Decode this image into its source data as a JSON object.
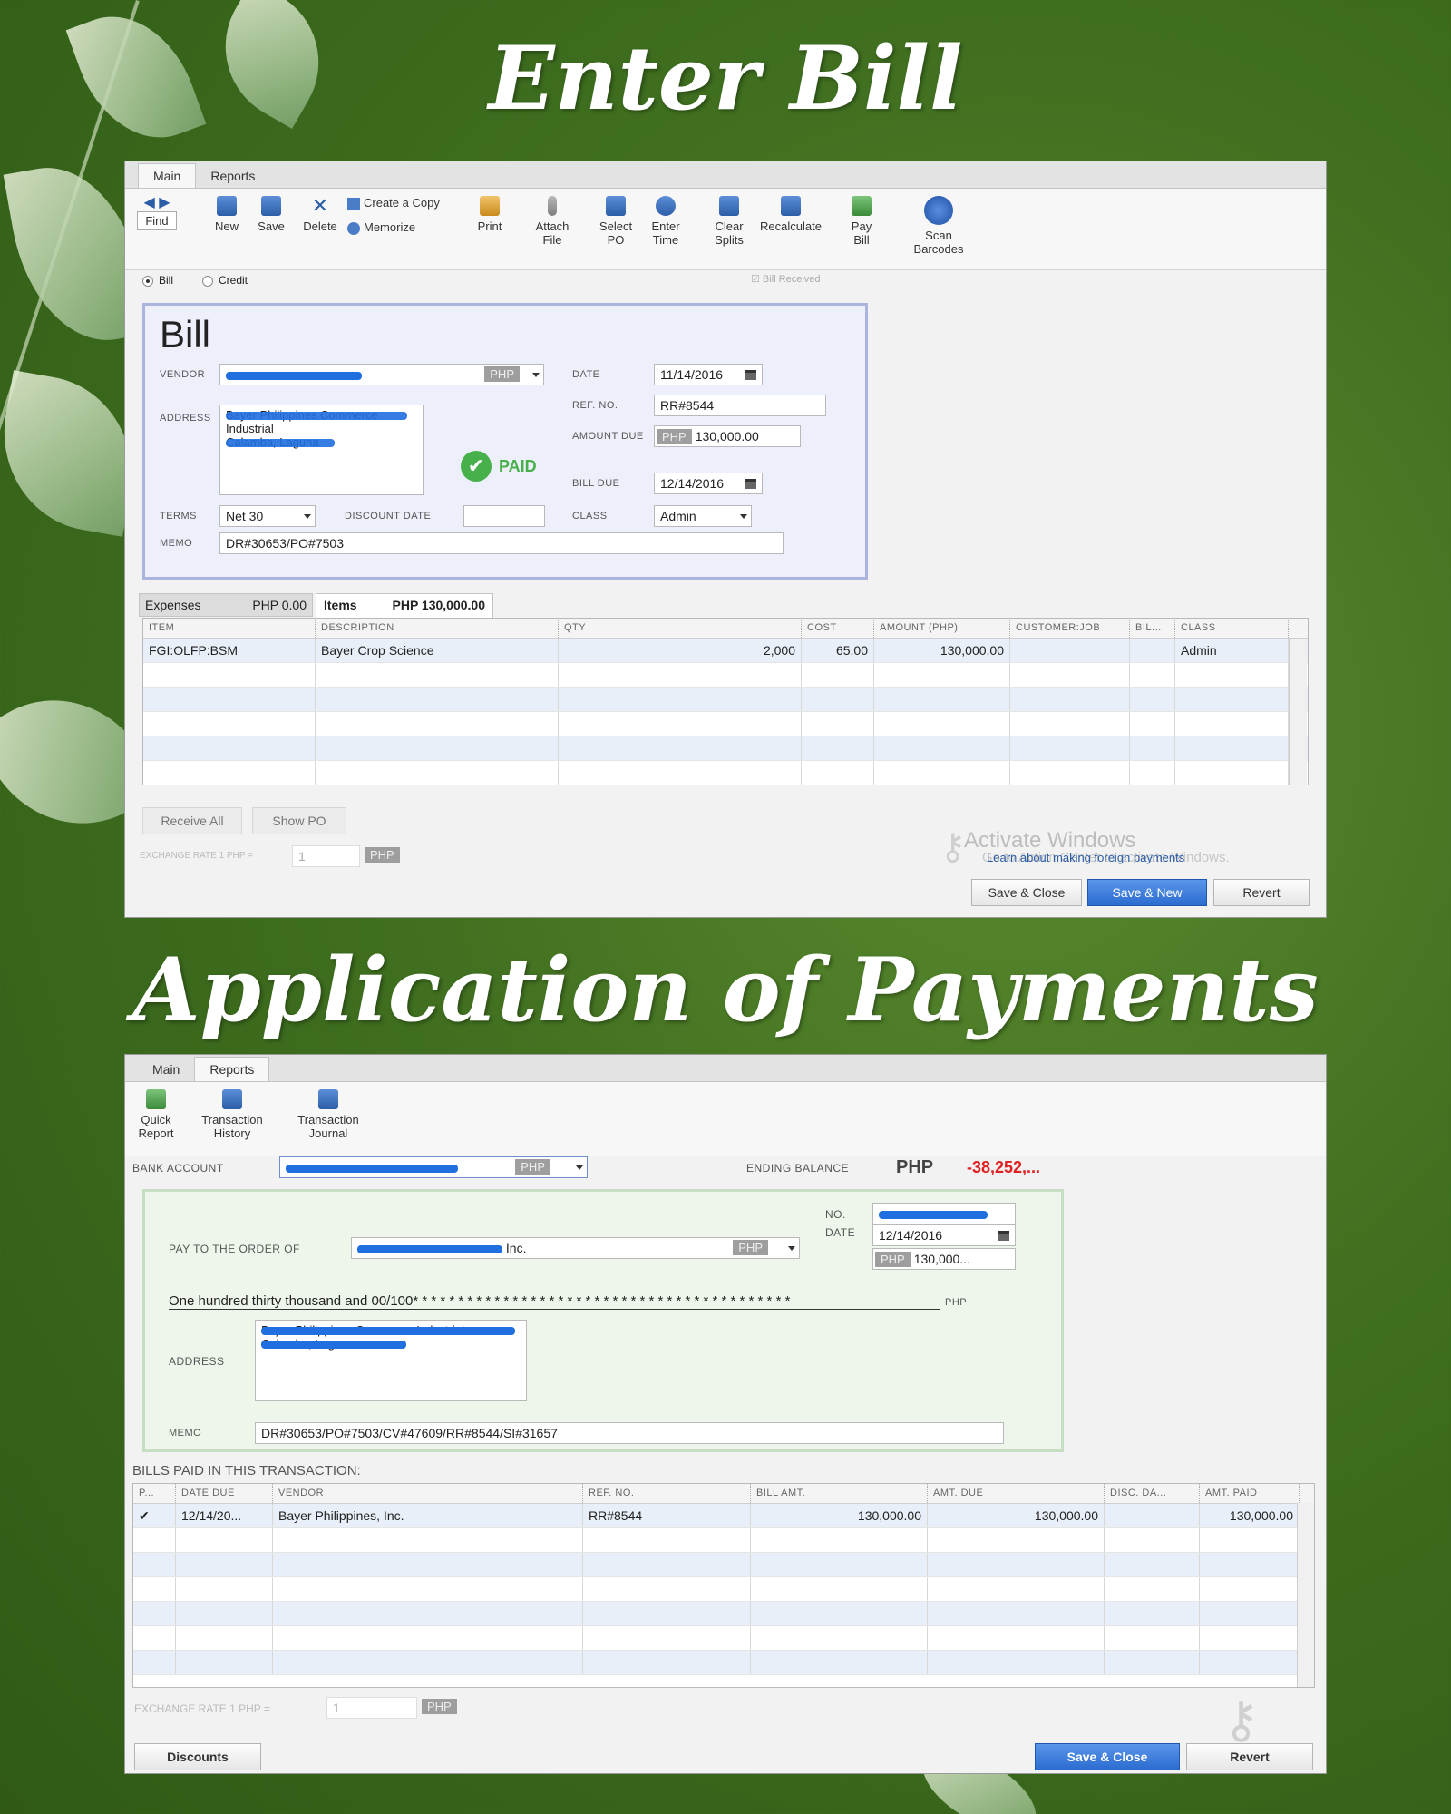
{
  "headings": {
    "enter_bill": "Enter Bill",
    "application_of_payments": "Application of Payments"
  },
  "bill_window": {
    "tabs": [
      "Main",
      "Reports"
    ],
    "toolbar": {
      "find": "Find",
      "new": "New",
      "save": "Save",
      "delete": "Delete",
      "create_copy": "Create a Copy",
      "memorize": "Memorize",
      "print": "Print",
      "attach_file": "Attach File",
      "select_po": "Select PO",
      "enter_time": "Enter Time",
      "clear_splits": "Clear Splits",
      "recalculate": "Recalculate",
      "pay_bill": "Pay Bill",
      "scan_barcodes": "Scan Barcodes"
    },
    "radio_bill": "Bill",
    "radio_credit": "Credit",
    "bill_received": "Bill Received",
    "form": {
      "title": "Bill",
      "vendor_label": "VENDOR",
      "vendor_currency": "PHP",
      "address_label": "ADDRESS",
      "address_line1": "Bayer Philippines Commerce Industrial",
      "address_line2": "Calamba, Laguna",
      "date_label": "DATE",
      "date": "11/14/2016",
      "ref_label": "REF. NO.",
      "ref_no": "RR#8544",
      "amount_due_label": "AMOUNT DUE",
      "amount_currency": "PHP",
      "amount_due": "130,000.00",
      "paid_stamp": "PAID",
      "bill_due_label": "BILL DUE",
      "bill_due": "12/14/2016",
      "terms_label": "TERMS",
      "terms": "Net 30",
      "discount_date_label": "DISCOUNT DATE",
      "class_label": "CLASS",
      "class": "Admin",
      "memo_label": "MEMO",
      "memo": "DR#30653/PO#7503"
    },
    "detail_tabs": {
      "expenses_label": "Expenses",
      "expenses_amount": "PHP  0.00",
      "items_label": "Items",
      "items_amount": "PHP  130,000.00"
    },
    "items_columns": [
      "ITEM",
      "DESCRIPTION",
      "QTY",
      "COST",
      "AMOUNT (PHP)",
      "CUSTOMER:JOB",
      "BIL...",
      "CLASS"
    ],
    "items_rows": [
      {
        "item": "FGI:OLFP:BSM",
        "description": "Bayer Crop Science",
        "qty": "2,000",
        "cost": "65.00",
        "amount": "130,000.00",
        "customer_job": "",
        "billable": "",
        "class": "Admin"
      }
    ],
    "receive_all": "Receive All",
    "show_po": "Show PO",
    "exchange_rate_label": "EXCHANGE RATE 1 PHP =",
    "exchange_rate": "1",
    "exchange_currency": "PHP",
    "foreign_link": "Learn about making foreign payments",
    "activate_title": "Activate Windows",
    "activate_sub": "Go to Action Center to activate Windows.",
    "buttons": {
      "save_close": "Save & Close",
      "save_new": "Save & New",
      "revert": "Revert"
    }
  },
  "payment_window": {
    "tabs": [
      "Main",
      "Reports"
    ],
    "toolbar": {
      "quick_report": "Quick Report",
      "transaction_history": "Transaction History",
      "transaction_journal": "Transaction Journal"
    },
    "bank_account_label": "BANK ACCOUNT",
    "bank_currency": "PHP",
    "ending_balance_label": "ENDING BALANCE",
    "ending_currency": "PHP",
    "ending_balance": "-38,252,...",
    "check": {
      "no_label": "NO.",
      "date_label": "DATE",
      "date": "12/14/2016",
      "amount_currency": "PHP",
      "amount": "130,000...",
      "pay_to_label": "PAY TO THE ORDER OF",
      "pay_to_suffix": "Inc.",
      "pay_currency": "PHP",
      "amount_words": "One hundred thirty thousand  and 00/100* * * * * * * * * * * * * * * * * * * * * * * * * * * * * * * * * * * * * * * * * *",
      "words_currency": "PHP",
      "address_label": "ADDRESS",
      "address_line1": "Bayer Philippines Commerce Industrial",
      "address_line2": "Calamba, Laguna",
      "memo_label": "MEMO",
      "memo": "DR#30653/PO#7503/CV#47609/RR#8544/SI#31657"
    },
    "bills_paid_label": "BILLS PAID IN THIS TRANSACTION:",
    "bills_columns": [
      "P...",
      "DATE DUE",
      "VENDOR",
      "REF. NO.",
      "BILL AMT.",
      "AMT. DUE",
      "DISC. DA...",
      "AMT. PAID"
    ],
    "bills_rows": [
      {
        "paid": "✔",
        "date_due": "12/14/20...",
        "vendor": "Bayer Philippines, Inc.",
        "ref_no": "RR#8544",
        "bill_amt": "130,000.00",
        "amt_due": "130,000.00",
        "disc_date": "",
        "amt_paid": "130,000.00"
      }
    ],
    "exchange_rate_label": "EXCHANGE RATE 1 PHP =",
    "exchange_rate": "1",
    "exchange_currency": "PHP",
    "buttons": {
      "discounts": "Discounts",
      "save_close": "Save & Close",
      "revert": "Revert"
    }
  }
}
